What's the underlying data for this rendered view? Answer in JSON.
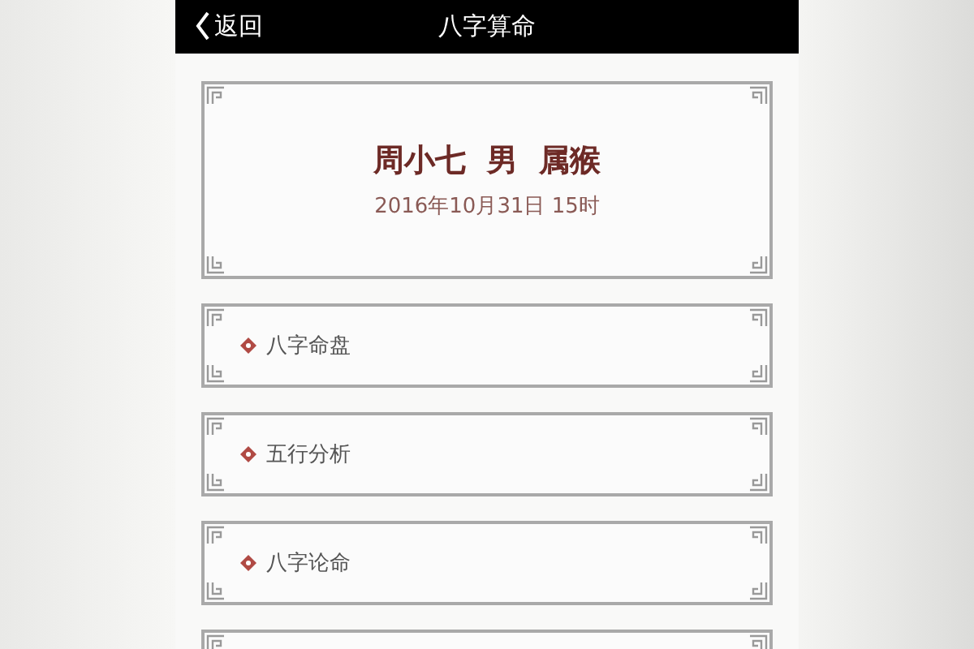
{
  "header": {
    "back_label": "返回",
    "title": "八字算命"
  },
  "profile": {
    "name_line": "周小七  男  属猴",
    "birth": "2016年10月31日 15时"
  },
  "menu": [
    {
      "label": "八字命盘"
    },
    {
      "label": "五行分析"
    },
    {
      "label": "八字论命"
    }
  ]
}
